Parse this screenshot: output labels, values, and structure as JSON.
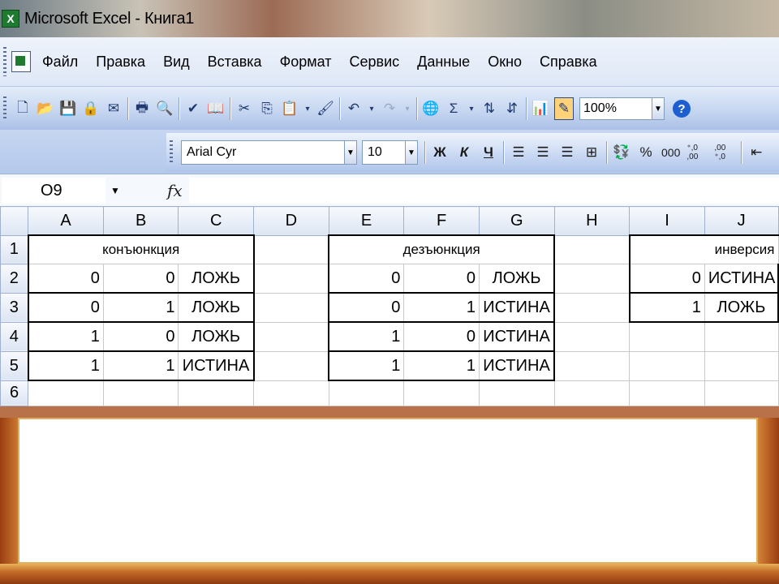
{
  "window": {
    "title": "Microsoft Excel - Книга1",
    "app_icon": "X"
  },
  "menu": [
    "Файл",
    "Правка",
    "Вид",
    "Вставка",
    "Формат",
    "Сервис",
    "Данные",
    "Окно",
    "Справка"
  ],
  "toolbar": {
    "sum_glyph": "Σ",
    "zoom": "100%",
    "help_glyph": "?"
  },
  "format_toolbar": {
    "font": "Arial Cyr",
    "size": "10",
    "bold": "Ж",
    "italic": "К",
    "underline": "Ч",
    "percent": "%",
    "thousands": "000",
    "inc_decimal": "⁺,0 ,00",
    "dec_decimal": ",00 ⁺,0"
  },
  "formula_bar": {
    "cell_ref": "O9",
    "fx": "fx",
    "value": ""
  },
  "grid": {
    "columns": [
      "A",
      "B",
      "C",
      "D",
      "E",
      "F",
      "G",
      "H",
      "I",
      "J"
    ],
    "rows": [
      {
        "n": "1",
        "cells": [
          "",
          "конъюнкция",
          "",
          "",
          "",
          "дезъюнкция",
          "",
          "",
          "",
          "инверсия"
        ]
      },
      {
        "n": "2",
        "cells": [
          "0",
          "0",
          "ЛОЖЬ",
          "",
          "0",
          "0",
          "ЛОЖЬ",
          "",
          "0",
          "ИСТИНА"
        ]
      },
      {
        "n": "3",
        "cells": [
          "0",
          "1",
          "ЛОЖЬ",
          "",
          "0",
          "1",
          "ИСТИНА",
          "",
          "1",
          "ЛОЖЬ"
        ]
      },
      {
        "n": "4",
        "cells": [
          "1",
          "0",
          "ЛОЖЬ",
          "",
          "1",
          "0",
          "ИСТИНА",
          "",
          "",
          ""
        ]
      },
      {
        "n": "5",
        "cells": [
          "1",
          "1",
          "ИСТИНА",
          "",
          "1",
          "1",
          "ИСТИНА",
          "",
          "",
          ""
        ]
      },
      {
        "n": "6",
        "cells": [
          "",
          "",
          "",
          "",
          "",
          "",
          "",
          "",
          "",
          ""
        ]
      }
    ]
  }
}
